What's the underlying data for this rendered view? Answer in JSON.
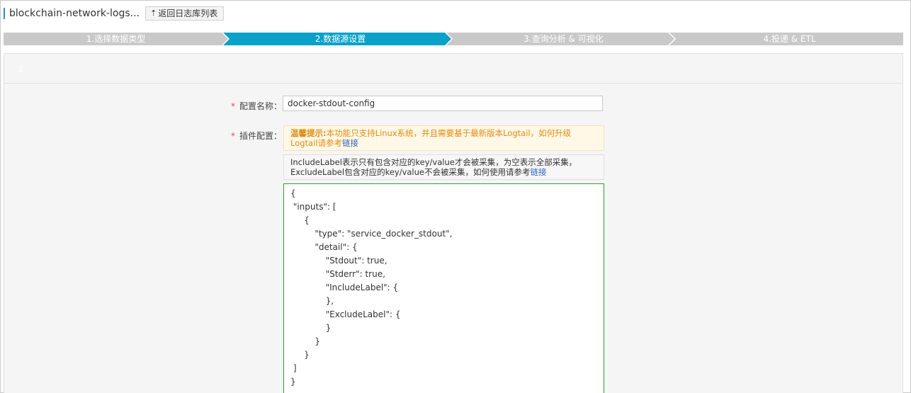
{
  "header": {
    "title": "blockchain-network-logs...",
    "back_label": "返回日志库列表",
    "back_icon": "upload-arrow-icon",
    "accent": "#2a8bd0"
  },
  "steps": [
    {
      "label": "1.选择数据类型",
      "active": false
    },
    {
      "label": "2.数据源设置",
      "active": true
    },
    {
      "label": "3.查询分析 & 可视化",
      "active": false
    },
    {
      "label": "4.投递 & ETL",
      "active": false
    }
  ],
  "colors": {
    "step_active": "#0aa1c9",
    "step_inactive": "#c9c9c9",
    "editor_border": "#2ca02c",
    "required": "#e84a3b",
    "tip_text": "#e38b12",
    "link": "#2a64c0"
  },
  "panel": {
    "head_mark": "2"
  },
  "form": {
    "config_name": {
      "required_mark": "*",
      "label": "配置名称：",
      "value": "docker-stdout-config"
    },
    "plugin_config": {
      "required_mark": "*",
      "label": "插件配置：",
      "tip": {
        "title": "温馨提示:",
        "text_line1": "本功能只支持Linux系统，并且需要基于最新版本Logtail，如何升级",
        "text_line2": "Logtail请参考",
        "link": "链接"
      },
      "info": {
        "line1": "IncludeLabel表示只有包含对应的key/value才会被采集，为空表示全部采集，",
        "line2": "ExcludeLabel包含对应的key/value不会被采集，如何使用请参考",
        "link": "链接"
      },
      "code_lines": [
        "{",
        " \"inputs\": [",
        "     {",
        "         \"type\": \"service_docker_stdout\",",
        "         \"detail\": {",
        "             \"Stdout\": true,",
        "             \"Stderr\": true,",
        "             \"IncludeLabel\": {",
        "             },",
        "             \"ExcludeLabel\": {",
        "             }",
        "         }",
        "     }",
        " ]",
        "}"
      ]
    }
  }
}
